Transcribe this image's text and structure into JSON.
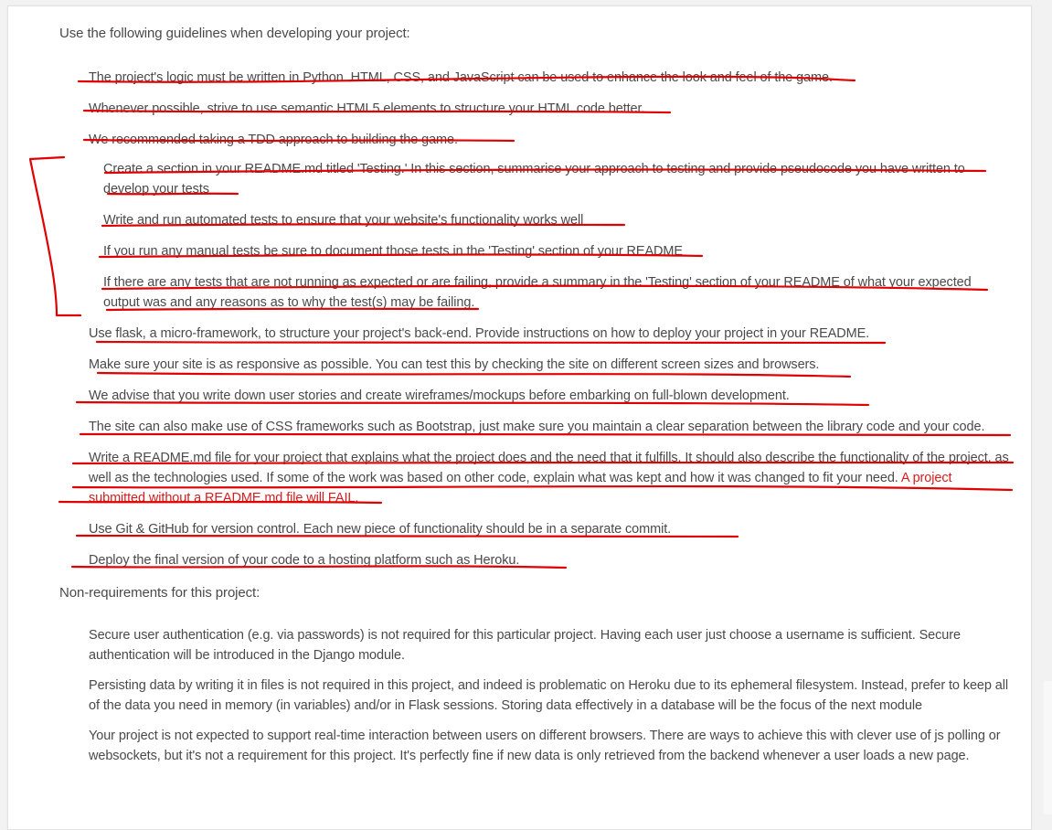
{
  "intro": "Use the following guidelines when developing your project:",
  "requirements": [
    "The project's logic must be written in Python. HTML, CSS, and JavaScript can be used to enhance the look and feel of the game.",
    "Whenever possible, strive to use semantic HTML5 elements to structure your HTML code better.",
    "We recommended taking a TDD approach to building the game."
  ],
  "testing": [
    "Create a section in your README.md titled 'Testing.' In this section, summarise your approach to testing and provide pseudocode you have written to develop your tests",
    "Write and run automated tests to ensure that your website's functionality works well",
    "If you run any manual tests be sure to document those tests in the 'Testing' section of your README",
    "If there are any tests that are not running as expected or are failing, provide a summary in the 'Testing' section of your README of what your expected output was and any reasons as to why the test(s) may be failing."
  ],
  "requirements_more": [
    "Use flask, a micro-framework, to structure your project's back-end. Provide instructions on how to deploy your project in your README.",
    "Make sure your site is as responsive as possible. You can test this by checking the site on different screen sizes and browsers.",
    "We advise that you write down user stories and create wireframes/mockups before embarking on full-blown development.",
    "The site can also make use of CSS frameworks such as Bootstrap, just make sure you maintain a clear separation between the library code and your code."
  ],
  "readme_item": {
    "text": "Write a README.md file for your project that explains what the project does and the need that it fulfills. It should also describe the functionality of the project, as well as the technologies used. If some of the work was based on other code, explain what was kept and how it was changed to fit your need. ",
    "warning": "A project submitted without a README.md file will FAIL."
  },
  "requirements_last": [
    "Use Git & GitHub for version control. Each new piece of functionality should be in a separate commit.",
    "Deploy the final version of your code to a hosting platform such as Heroku."
  ],
  "nonreq_heading": "Non-requirements for this project:",
  "nonrequirements": [
    "Secure user authentication (e.g. via passwords) is not required for this particular project. Having each user just choose a username is sufficient. Secure authentication will be introduced in the Django module.",
    "Persisting data by writing it in files is not required in this project, and indeed is problematic on Heroku due to its ephemeral filesystem. Instead, prefer to keep all of the data you need in memory (in variables) and/or in Flask sessions. Storing data effectively in a database will be the focus of the next module",
    "Your project is not expected to support real-time interaction between users on different browsers. There are ways to achieve this with clever use of js polling or websockets, but it's not a requirement for this project. It's perfectly fine if new data is only retrieved from the backend whenever a user loads a new page."
  ],
  "colors": {
    "text": "#4a4a4a",
    "annotation": "#e00000",
    "warning": "#d71d1d"
  }
}
